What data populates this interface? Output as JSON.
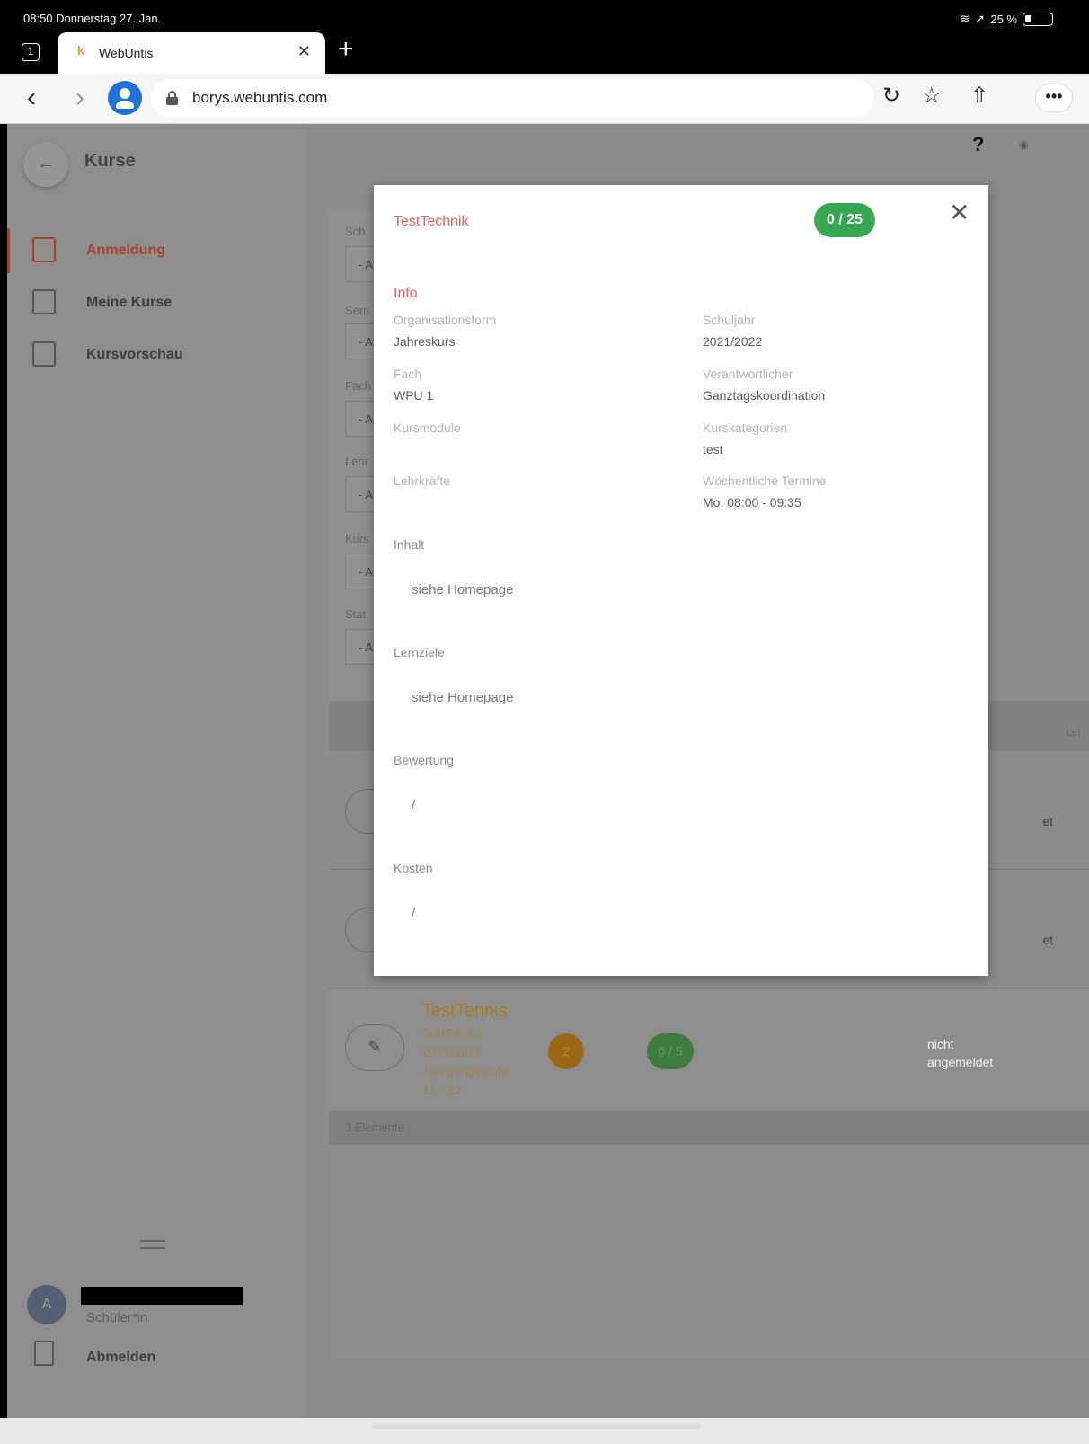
{
  "status": {
    "time": "08:50",
    "date": "Donnerstag 27. Jan.",
    "battery": "25 %"
  },
  "browser": {
    "tab_count": "1",
    "tab_title": "WebUntis",
    "url": "borys.webuntis.com",
    "more": "•••"
  },
  "sidebar": {
    "title": "Kurse",
    "items": [
      {
        "label": "Anmeldung"
      },
      {
        "label": "Meine Kurse"
      },
      {
        "label": "Kursvorschau"
      }
    ],
    "user_initial": "A",
    "user_role": "Schüler*in",
    "logout": "Abmelden"
  },
  "main": {
    "help": "?",
    "filter_labels": [
      "Sch",
      "Sem",
      "Fach",
      "Lehr",
      "Kurs",
      "Stat"
    ],
    "filter_value": "- A",
    "list_head_right": "Lei",
    "rows_status_partial": [
      "et",
      "et"
    ],
    "row3": {
      "title": "TestTennis",
      "sub1": "TestTennis",
      "sub2": "2021/2022",
      "sub3": "Jahrgangsstufe",
      "sub4": "12 - 12",
      "badge": "2",
      "capacity": "0 / 5",
      "status_line1": "nicht",
      "status_line2": "angemeldet"
    },
    "count_label": "3 Elemente"
  },
  "modal": {
    "title": "TestTechnik",
    "capacity": "0 / 25",
    "section": "Info",
    "fields": {
      "organisationsform_label": "Organisationsform",
      "organisationsform_value": "Jahreskurs",
      "schuljahr_label": "Schuljahr",
      "schuljahr_value": "2021/2022",
      "fach_label": "Fach",
      "fach_value": "WPU 1",
      "verantwortlicher_label": "Verantwortlicher",
      "verantwortlicher_value": "Ganztagskoordination",
      "kursmodule_label": "Kursmodule",
      "kurskategorien_label": "Kurskategorien",
      "kurskategorien_value": "test",
      "lehrkraefte_label": "Lehrkräfte",
      "termine_label": "Wöchentliche Termine",
      "termine_value": "Mo. 08:00 - 09:35"
    },
    "inhalt_label": "Inhalt",
    "inhalt_value": "siehe Homepage",
    "lernziele_label": "Lernziele",
    "lernziele_value": "siehe Homepage",
    "bewertung_label": "Bewertung",
    "bewertung_value": "/",
    "kosten_label": "Kosten",
    "kosten_value": "/"
  }
}
